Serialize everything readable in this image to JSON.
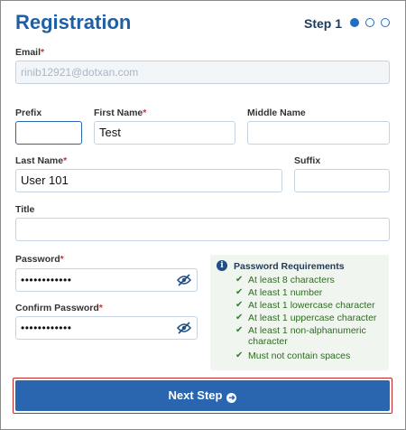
{
  "header": {
    "title": "Registration",
    "step_label": "Step 1"
  },
  "form": {
    "email": {
      "label": "Email",
      "value": "rinib12921@dotxan.com"
    },
    "prefix": {
      "label": "Prefix",
      "value": ""
    },
    "first_name": {
      "label": "First Name",
      "value": "Test"
    },
    "middle_name": {
      "label": "Middle Name",
      "value": ""
    },
    "last_name": {
      "label": "Last Name",
      "value": "User 101"
    },
    "suffix": {
      "label": "Suffix",
      "value": ""
    },
    "title": {
      "label": "Title",
      "value": ""
    },
    "password": {
      "label": "Password",
      "value": "••••••••••••"
    },
    "confirm_password": {
      "label": "Confirm Password",
      "value": "••••••••••••"
    },
    "required_marker": "*"
  },
  "requirements": {
    "title": "Password Requirements",
    "items": [
      "At least 8 characters",
      "At least 1 number",
      "At least 1 lowercase character",
      "At least 1 uppercase character",
      "At least 1 non-alphanumeric character",
      "Must not contain spaces"
    ]
  },
  "actions": {
    "next_label": "Next Step"
  },
  "colors": {
    "accent": "#2a66b0",
    "title": "#1f5fa6",
    "success": "#2e7d32",
    "required": "#d0312d"
  }
}
